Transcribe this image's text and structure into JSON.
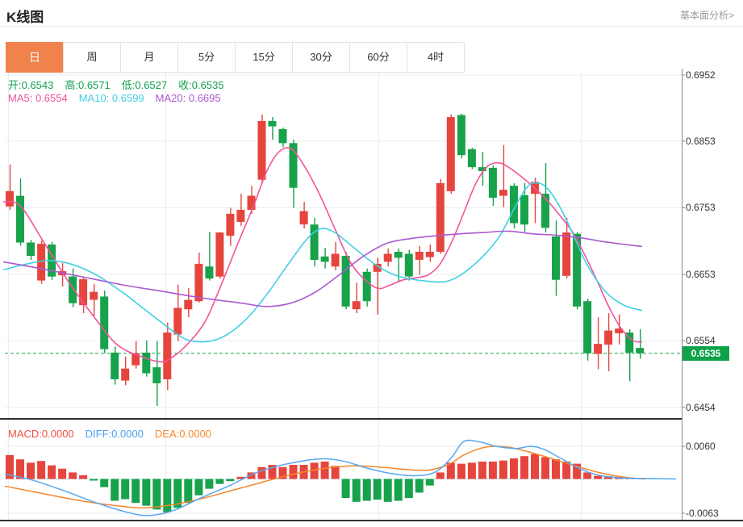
{
  "header": {
    "title": "K线图",
    "link_label": "基本面分析>"
  },
  "tabs": [
    {
      "label": "日",
      "active": true
    },
    {
      "label": "周",
      "active": false
    },
    {
      "label": "月",
      "active": false
    },
    {
      "label": "5分",
      "active": false
    },
    {
      "label": "15分",
      "active": false
    },
    {
      "label": "30分",
      "active": false
    },
    {
      "label": "60分",
      "active": false
    },
    {
      "label": "4时",
      "active": false
    }
  ],
  "legend": {
    "ohlc": [
      {
        "label": "开",
        "value": "0.6543",
        "color": "#14a14c"
      },
      {
        "label": "高",
        "value": "0.6571",
        "color": "#14a14c"
      },
      {
        "label": "低",
        "value": "0.6527",
        "color": "#14a14c"
      },
      {
        "label": "收",
        "value": "0.6535",
        "color": "#14a14c"
      }
    ],
    "ma": [
      {
        "label": "MA5",
        "value": "0.6554",
        "color": "#f2539b"
      },
      {
        "label": "MA10",
        "value": "0.6599",
        "color": "#41d0e5"
      },
      {
        "label": "MA20",
        "value": "0.6695",
        "color": "#ac59cf"
      }
    ],
    "macd": [
      {
        "label": "MACD",
        "value": "0.0000",
        "color": "#f0503f"
      },
      {
        "label": "DIFF",
        "value": "0.0000",
        "color": "#4aa0f0"
      },
      {
        "label": "DEA",
        "value": "0.0000",
        "color": "#f68a2c"
      }
    ]
  },
  "colors": {
    "up": "#e6453e",
    "down": "#17a24b",
    "ma5": "#f2539b",
    "ma10": "#41d0e5",
    "ma20": "#ac59cf",
    "diff": "#57a7f2",
    "dea": "#f5862b",
    "grid": "#e7edf4",
    "axis": "#888888",
    "separator": "#2f2f2f",
    "price_line": "#1ca24d",
    "price_tag_bg": "#10a24a",
    "zero_line": "#a9d9ea",
    "tab_active_bg": "#f0824c"
  },
  "chart_data": {
    "type": "candlestick",
    "title": "K线图",
    "indicator": "MACD",
    "price_axis_ticks": [
      {
        "label": "0.6952",
        "value": 0.6952
      },
      {
        "label": "0.6853",
        "value": 0.6853
      },
      {
        "label": "0.6753",
        "value": 0.6753
      },
      {
        "label": "0.6653",
        "value": 0.6653
      },
      {
        "label": "0.6554",
        "value": 0.6554
      },
      {
        "label": "0.6454",
        "value": 0.6454
      }
    ],
    "macd_axis_ticks": [
      {
        "label": "0.0060",
        "value": 0.006
      },
      {
        "label": "-0.0063",
        "value": -0.0063
      }
    ],
    "current_price": {
      "label": "0.6535",
      "value": 0.6535
    },
    "candles": [
      {
        "o": 0.6755,
        "h": 0.6818,
        "l": 0.675,
        "c": 0.6778
      },
      {
        "o": 0.6771,
        "h": 0.6797,
        "l": 0.6696,
        "c": 0.6701
      },
      {
        "o": 0.6701,
        "h": 0.6705,
        "l": 0.6675,
        "c": 0.6681
      },
      {
        "o": 0.6644,
        "h": 0.6704,
        "l": 0.6639,
        "c": 0.6699
      },
      {
        "o": 0.6698,
        "h": 0.6702,
        "l": 0.6645,
        "c": 0.665
      },
      {
        "o": 0.6652,
        "h": 0.667,
        "l": 0.6635,
        "c": 0.6658
      },
      {
        "o": 0.665,
        "h": 0.6662,
        "l": 0.6604,
        "c": 0.661
      },
      {
        "o": 0.6607,
        "h": 0.665,
        "l": 0.6595,
        "c": 0.6646
      },
      {
        "o": 0.6615,
        "h": 0.6639,
        "l": 0.6591,
        "c": 0.6627
      },
      {
        "o": 0.662,
        "h": 0.6629,
        "l": 0.6535,
        "c": 0.6541
      },
      {
        "o": 0.6536,
        "h": 0.6545,
        "l": 0.6488,
        "c": 0.6496
      },
      {
        "o": 0.6494,
        "h": 0.653,
        "l": 0.6487,
        "c": 0.6512
      },
      {
        "o": 0.6517,
        "h": 0.6553,
        "l": 0.6512,
        "c": 0.6535
      },
      {
        "o": 0.6536,
        "h": 0.6554,
        "l": 0.65,
        "c": 0.6505
      },
      {
        "o": 0.6514,
        "h": 0.6553,
        "l": 0.6456,
        "c": 0.649
      },
      {
        "o": 0.6496,
        "h": 0.6581,
        "l": 0.648,
        "c": 0.6566
      },
      {
        "o": 0.6563,
        "h": 0.6638,
        "l": 0.6553,
        "c": 0.6603
      },
      {
        "o": 0.6601,
        "h": 0.6633,
        "l": 0.6589,
        "c": 0.6615
      },
      {
        "o": 0.6613,
        "h": 0.6686,
        "l": 0.6611,
        "c": 0.6669
      },
      {
        "o": 0.6665,
        "h": 0.6717,
        "l": 0.6644,
        "c": 0.6647
      },
      {
        "o": 0.665,
        "h": 0.6717,
        "l": 0.6647,
        "c": 0.6716
      },
      {
        "o": 0.6711,
        "h": 0.6753,
        "l": 0.6696,
        "c": 0.6744
      },
      {
        "o": 0.6732,
        "h": 0.6774,
        "l": 0.6726,
        "c": 0.675
      },
      {
        "o": 0.675,
        "h": 0.6786,
        "l": 0.6744,
        "c": 0.6771
      },
      {
        "o": 0.6795,
        "h": 0.6893,
        "l": 0.679,
        "c": 0.6883
      },
      {
        "o": 0.6883,
        "h": 0.6889,
        "l": 0.6855,
        "c": 0.6875
      },
      {
        "o": 0.6871,
        "h": 0.6873,
        "l": 0.6844,
        "c": 0.685
      },
      {
        "o": 0.685,
        "h": 0.6855,
        "l": 0.6753,
        "c": 0.6783
      },
      {
        "o": 0.6728,
        "h": 0.6762,
        "l": 0.6722,
        "c": 0.6748
      },
      {
        "o": 0.6728,
        "h": 0.6738,
        "l": 0.6665,
        "c": 0.6675
      },
      {
        "o": 0.668,
        "h": 0.6693,
        "l": 0.6662,
        "c": 0.6672
      },
      {
        "o": 0.6665,
        "h": 0.6702,
        "l": 0.6659,
        "c": 0.6684
      },
      {
        "o": 0.6681,
        "h": 0.6687,
        "l": 0.6601,
        "c": 0.6605
      },
      {
        "o": 0.6601,
        "h": 0.6641,
        "l": 0.6595,
        "c": 0.6613
      },
      {
        "o": 0.6657,
        "h": 0.6662,
        "l": 0.6605,
        "c": 0.6613
      },
      {
        "o": 0.6657,
        "h": 0.6678,
        "l": 0.6593,
        "c": 0.6669
      },
      {
        "o": 0.6672,
        "h": 0.6692,
        "l": 0.6665,
        "c": 0.6684
      },
      {
        "o": 0.6687,
        "h": 0.6692,
        "l": 0.6641,
        "c": 0.6678
      },
      {
        "o": 0.6684,
        "h": 0.669,
        "l": 0.6644,
        "c": 0.665
      },
      {
        "o": 0.6675,
        "h": 0.6696,
        "l": 0.6653,
        "c": 0.6687
      },
      {
        "o": 0.6679,
        "h": 0.6698,
        "l": 0.6672,
        "c": 0.6687
      },
      {
        "o": 0.6687,
        "h": 0.6796,
        "l": 0.6684,
        "c": 0.679
      },
      {
        "o": 0.6778,
        "h": 0.6893,
        "l": 0.6774,
        "c": 0.6889
      },
      {
        "o": 0.6892,
        "h": 0.6894,
        "l": 0.6827,
        "c": 0.6832
      },
      {
        "o": 0.6841,
        "h": 0.6843,
        "l": 0.6811,
        "c": 0.6814
      },
      {
        "o": 0.6814,
        "h": 0.6837,
        "l": 0.6786,
        "c": 0.6808
      },
      {
        "o": 0.6813,
        "h": 0.6817,
        "l": 0.6756,
        "c": 0.6768
      },
      {
        "o": 0.6771,
        "h": 0.6847,
        "l": 0.6754,
        "c": 0.678
      },
      {
        "o": 0.6786,
        "h": 0.679,
        "l": 0.6722,
        "c": 0.673
      },
      {
        "o": 0.6772,
        "h": 0.679,
        "l": 0.6717,
        "c": 0.6728
      },
      {
        "o": 0.6774,
        "h": 0.6798,
        "l": 0.673,
        "c": 0.6792
      },
      {
        "o": 0.6774,
        "h": 0.682,
        "l": 0.6716,
        "c": 0.6723
      },
      {
        "o": 0.671,
        "h": 0.6734,
        "l": 0.6621,
        "c": 0.6645
      },
      {
        "o": 0.6651,
        "h": 0.6738,
        "l": 0.6647,
        "c": 0.6716
      },
      {
        "o": 0.6714,
        "h": 0.6717,
        "l": 0.6601,
        "c": 0.6605
      },
      {
        "o": 0.6613,
        "h": 0.6617,
        "l": 0.6524,
        "c": 0.6535
      },
      {
        "o": 0.6534,
        "h": 0.6589,
        "l": 0.6511,
        "c": 0.6549
      },
      {
        "o": 0.6548,
        "h": 0.6595,
        "l": 0.6508,
        "c": 0.6569
      },
      {
        "o": 0.6565,
        "h": 0.6593,
        "l": 0.6548,
        "c": 0.6572
      },
      {
        "o": 0.6566,
        "h": 0.6571,
        "l": 0.6493,
        "c": 0.6536
      },
      {
        "o": 0.6543,
        "h": 0.6571,
        "l": 0.6527,
        "c": 0.6535
      }
    ],
    "ma_lines": {
      "ma5": [
        [
          4,
          0.6762
        ],
        [
          25,
          0.6756
        ],
        [
          55,
          0.67
        ],
        [
          85,
          0.6642
        ],
        [
          115,
          0.6592
        ],
        [
          145,
          0.6548
        ],
        [
          175,
          0.653
        ],
        [
          200,
          0.6522
        ],
        [
          215,
          0.653
        ],
        [
          235,
          0.6552
        ],
        [
          255,
          0.6584
        ],
        [
          275,
          0.664
        ],
        [
          295,
          0.67
        ],
        [
          315,
          0.6758
        ],
        [
          330,
          0.6806
        ],
        [
          345,
          0.6836
        ],
        [
          360,
          0.6842
        ],
        [
          375,
          0.682
        ],
        [
          395,
          0.6776
        ],
        [
          415,
          0.6722
        ],
        [
          435,
          0.667
        ],
        [
          455,
          0.6642
        ],
        [
          470,
          0.6632
        ],
        [
          485,
          0.6638
        ],
        [
          500,
          0.6645
        ],
        [
          515,
          0.6648
        ],
        [
          530,
          0.6652
        ],
        [
          545,
          0.6668
        ],
        [
          560,
          0.6702
        ],
        [
          575,
          0.6746
        ],
        [
          590,
          0.679
        ],
        [
          605,
          0.6816
        ],
        [
          620,
          0.682
        ],
        [
          635,
          0.681
        ],
        [
          650,
          0.6796
        ],
        [
          665,
          0.678
        ],
        [
          680,
          0.6762
        ],
        [
          695,
          0.674
        ],
        [
          710,
          0.6716
        ],
        [
          725,
          0.6682
        ],
        [
          740,
          0.6644
        ],
        [
          755,
          0.6604
        ],
        [
          770,
          0.6572
        ],
        [
          785,
          0.6554
        ],
        [
          796,
          0.6552
        ]
      ],
      "ma10": [
        [
          4,
          0.666
        ],
        [
          30,
          0.6668
        ],
        [
          60,
          0.6674
        ],
        [
          90,
          0.6668
        ],
        [
          120,
          0.6652
        ],
        [
          150,
          0.6628
        ],
        [
          180,
          0.66
        ],
        [
          210,
          0.6572
        ],
        [
          230,
          0.6556
        ],
        [
          250,
          0.6552
        ],
        [
          270,
          0.6556
        ],
        [
          290,
          0.657
        ],
        [
          310,
          0.6592
        ],
        [
          330,
          0.6622
        ],
        [
          350,
          0.6656
        ],
        [
          370,
          0.669
        ],
        [
          385,
          0.6712
        ],
        [
          400,
          0.6722
        ],
        [
          415,
          0.6716
        ],
        [
          430,
          0.6702
        ],
        [
          450,
          0.6682
        ],
        [
          470,
          0.6664
        ],
        [
          490,
          0.6652
        ],
        [
          510,
          0.6646
        ],
        [
          530,
          0.6643
        ],
        [
          550,
          0.6642
        ],
        [
          565,
          0.6648
        ],
        [
          580,
          0.666
        ],
        [
          600,
          0.6682
        ],
        [
          620,
          0.6712
        ],
        [
          640,
          0.6758
        ],
        [
          655,
          0.6786
        ],
        [
          668,
          0.679
        ],
        [
          680,
          0.678
        ],
        [
          695,
          0.6752
        ],
        [
          710,
          0.6714
        ],
        [
          725,
          0.6674
        ],
        [
          740,
          0.6644
        ],
        [
          755,
          0.6622
        ],
        [
          775,
          0.6606
        ],
        [
          796,
          0.6599
        ]
      ],
      "ma20": [
        [
          4,
          0.6672
        ],
        [
          50,
          0.6662
        ],
        [
          100,
          0.665
        ],
        [
          150,
          0.6638
        ],
        [
          200,
          0.6628
        ],
        [
          250,
          0.6618
        ],
        [
          300,
          0.661
        ],
        [
          330,
          0.6605
        ],
        [
          360,
          0.661
        ],
        [
          390,
          0.6626
        ],
        [
          420,
          0.6652
        ],
        [
          450,
          0.668
        ],
        [
          480,
          0.67
        ],
        [
          510,
          0.6707
        ],
        [
          540,
          0.6711
        ],
        [
          570,
          0.6714
        ],
        [
          600,
          0.6716
        ],
        [
          630,
          0.6718
        ],
        [
          660,
          0.6714
        ],
        [
          690,
          0.6712
        ],
        [
          720,
          0.6708
        ],
        [
          750,
          0.6702
        ],
        [
          775,
          0.6698
        ],
        [
          796,
          0.6695
        ]
      ]
    },
    "macd": {
      "histogram": [
        0.0044,
        0.0036,
        0.003,
        0.0033,
        0.0025,
        0.0019,
        0.0012,
        0.0007,
        -0.0003,
        -0.0015,
        -0.004,
        -0.0037,
        -0.0044,
        -0.0049,
        -0.0056,
        -0.0061,
        -0.0053,
        -0.0044,
        -0.003,
        -0.0018,
        -0.0009,
        -0.0004,
        0.0004,
        0.0012,
        0.0022,
        0.0026,
        0.0022,
        0.0026,
        0.0026,
        0.003,
        0.0032,
        0.0024,
        -0.0035,
        -0.0042,
        -0.004,
        -0.0038,
        -0.0042,
        -0.004,
        -0.0035,
        -0.0025,
        -0.0012,
        0.0012,
        0.003,
        0.0028,
        0.003,
        0.0032,
        0.0032,
        0.0034,
        0.0038,
        0.0042,
        0.0046,
        0.004,
        0.0036,
        0.0032,
        0.0028,
        0.0012,
        0.0006,
        0.0005,
        0.0004,
        0.0003,
        0.0002
      ],
      "diff": [
        [
          6,
          0.0009
        ],
        [
          40,
          -0.0002
        ],
        [
          80,
          -0.0022
        ],
        [
          120,
          -0.0044
        ],
        [
          160,
          -0.0062
        ],
        [
          185,
          -0.0067
        ],
        [
          215,
          -0.0058
        ],
        [
          250,
          -0.0034
        ],
        [
          285,
          -0.0012
        ],
        [
          315,
          0.001
        ],
        [
          345,
          0.0024
        ],
        [
          375,
          0.0033
        ],
        [
          400,
          0.0037
        ],
        [
          425,
          0.0033
        ],
        [
          455,
          0.002
        ],
        [
          485,
          0.001
        ],
        [
          515,
          0.0006
        ],
        [
          540,
          0.0013
        ],
        [
          560,
          0.004
        ],
        [
          575,
          0.0069
        ],
        [
          595,
          0.0068
        ],
        [
          615,
          0.006
        ],
        [
          640,
          0.0056
        ],
        [
          658,
          0.006
        ],
        [
          675,
          0.0054
        ],
        [
          695,
          0.0038
        ],
        [
          712,
          0.0024
        ],
        [
          730,
          0.0012
        ],
        [
          750,
          0.0005
        ],
        [
          770,
          0.0002
        ],
        [
          795,
          0.0001
        ],
        [
          838,
          0.0
        ]
      ],
      "dea": [
        [
          6,
          -0.0013
        ],
        [
          50,
          -0.0026
        ],
        [
          100,
          -0.004
        ],
        [
          150,
          -0.005
        ],
        [
          180,
          -0.0053
        ],
        [
          215,
          -0.0047
        ],
        [
          250,
          -0.0036
        ],
        [
          290,
          -0.002
        ],
        [
          320,
          -0.0008
        ],
        [
          350,
          0.0004
        ],
        [
          380,
          0.0014
        ],
        [
          410,
          0.0021
        ],
        [
          440,
          0.0024
        ],
        [
          470,
          0.0022
        ],
        [
          500,
          0.0018
        ],
        [
          530,
          0.0016
        ],
        [
          555,
          0.0026
        ],
        [
          575,
          0.0044
        ],
        [
          595,
          0.0056
        ],
        [
          612,
          0.006
        ],
        [
          632,
          0.0058
        ],
        [
          655,
          0.005
        ],
        [
          678,
          0.004
        ],
        [
          700,
          0.003
        ],
        [
          722,
          0.002
        ],
        [
          742,
          0.0012
        ],
        [
          762,
          0.0006
        ],
        [
          782,
          0.0002
        ],
        [
          800,
          0.0
        ]
      ]
    }
  }
}
